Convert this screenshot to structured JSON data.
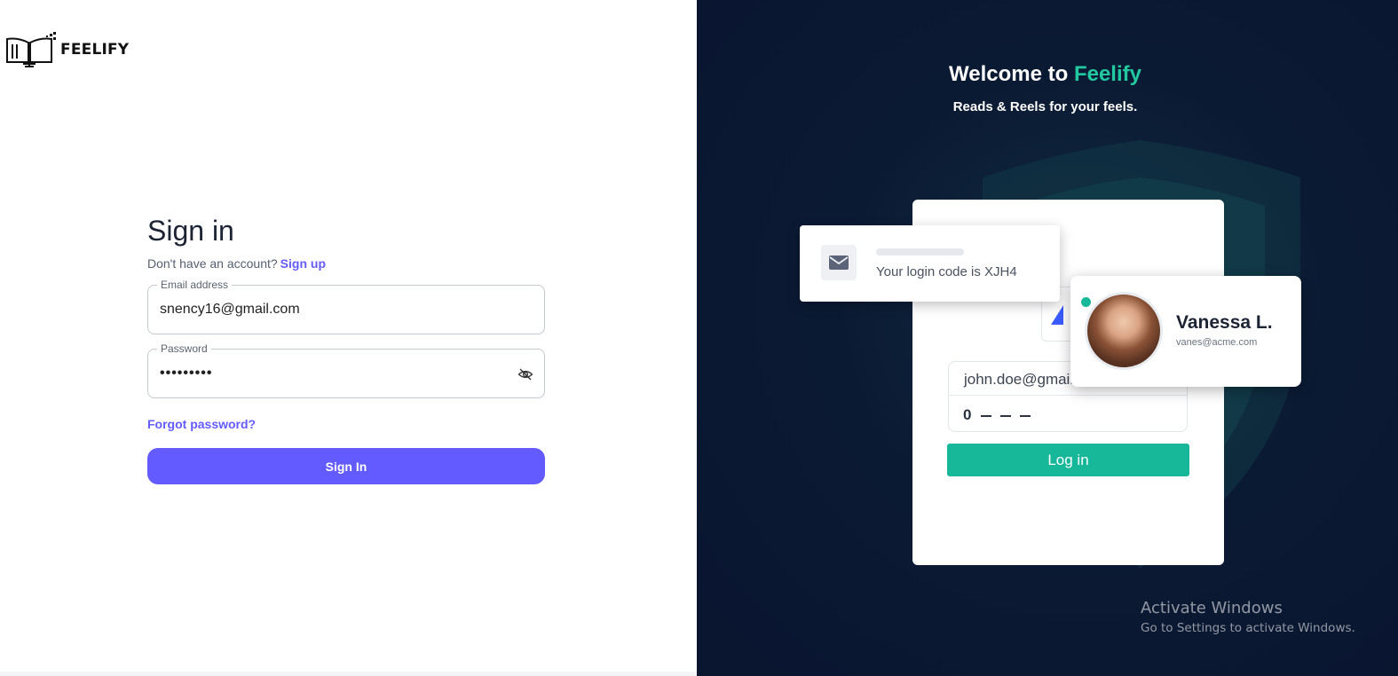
{
  "brand": {
    "logo_text": "FEELIFY",
    "accent": "#635bff",
    "teal": "#22c9a0"
  },
  "signin": {
    "title": "Sign in",
    "no_account_text": "Don't have an account?",
    "signup_link": "Sign up",
    "email": {
      "label": "Email address",
      "value": "snency16@gmail.com"
    },
    "password": {
      "label": "Password",
      "value": "•••••••••",
      "toggle_icon": "eye-off-icon"
    },
    "forgot_link": "Forgot password?",
    "submit_label": "Sign In"
  },
  "hero": {
    "welcome_prefix": "Welcome to",
    "welcome_brand": "Feelify",
    "tagline": "Reads & Reels for your feels.",
    "code_card": {
      "icon": "mail-icon",
      "text": "Your login code is XJH4"
    },
    "login_card": {
      "email": "john.doe@gmail",
      "code_first": "0",
      "button": "Log in"
    },
    "user_card": {
      "name": "Vanessa L.",
      "email": "vanes@acme.com",
      "verified_icon": "check-icon"
    }
  },
  "os_overlay": {
    "title": "Activate Windows",
    "subtitle": "Go to Settings to activate Windows."
  }
}
